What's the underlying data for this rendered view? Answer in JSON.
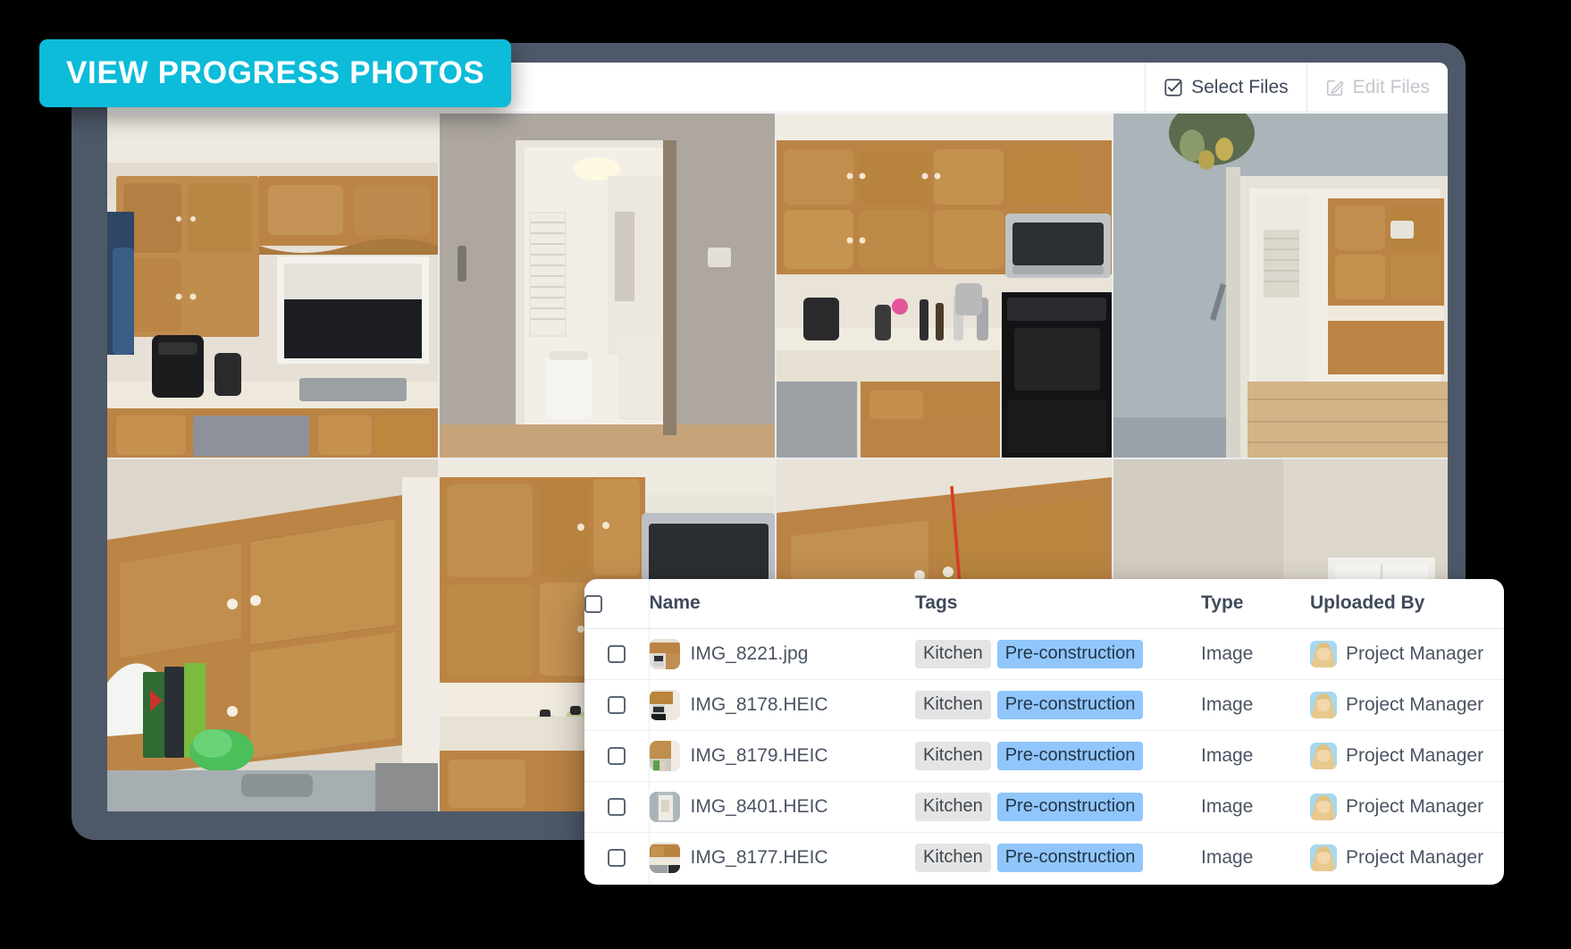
{
  "badge": {
    "label": "VIEW PROGRESS PHOTOS",
    "color": "#0cbcd9"
  },
  "card": {
    "background": "#4d5969"
  },
  "toolbar": {
    "buttons": [
      {
        "label": "Select Files",
        "icon": "checkbox-check-icon",
        "disabled": false
      },
      {
        "label": "Edit Files",
        "icon": "pencil-square-icon",
        "disabled": true
      }
    ]
  },
  "photo_grid": {
    "columns": 4,
    "rows": 2,
    "cells": [
      {
        "alt": "kitchen-oak-cabinets-window-sink"
      },
      {
        "alt": "hallway-doorway-to-bathroom"
      },
      {
        "alt": "kitchen-oak-cabinets-microwave-stove"
      },
      {
        "alt": "hallway-view-into-kitchen"
      },
      {
        "alt": "kitchen-cabinets-cereal-boxes-sink"
      },
      {
        "alt": "kitchen-cabinets-stove-kettle"
      },
      {
        "alt": "kitchen-upper-cabinets-wall"
      },
      {
        "alt": "empty-room-with-window"
      }
    ]
  },
  "file_table": {
    "headers": {
      "select_all": "",
      "name": "Name",
      "tags": "Tags",
      "type": "Type",
      "uploaded_by": "Uploaded By"
    },
    "tag_colors": {
      "gray": "#e4e4e4",
      "blue": "#90c6fb"
    },
    "rows": [
      {
        "checked": false,
        "thumb": "thumb-kitchen-1",
        "name": "IMG_8221.jpg",
        "tags": [
          "Kitchen",
          "Pre-construction"
        ],
        "type": "Image",
        "uploaded_by": "Project Manager",
        "avatar": "avatar-project-manager"
      },
      {
        "checked": false,
        "thumb": "thumb-kitchen-2",
        "name": "IMG_8178.HEIC",
        "tags": [
          "Kitchen",
          "Pre-construction"
        ],
        "type": "Image",
        "uploaded_by": "Project Manager",
        "avatar": "avatar-project-manager"
      },
      {
        "checked": false,
        "thumb": "thumb-kitchen-3",
        "name": "IMG_8179.HEIC",
        "tags": [
          "Kitchen",
          "Pre-construction"
        ],
        "type": "Image",
        "uploaded_by": "Project Manager",
        "avatar": "avatar-project-manager"
      },
      {
        "checked": false,
        "thumb": "thumb-kitchen-4",
        "name": "IMG_8401.HEIC",
        "tags": [
          "Kitchen",
          "Pre-construction"
        ],
        "type": "Image",
        "uploaded_by": "Project Manager",
        "avatar": "avatar-project-manager"
      },
      {
        "checked": false,
        "thumb": "thumb-kitchen-5",
        "name": "IMG_8177.HEIC",
        "tags": [
          "Kitchen",
          "Pre-construction"
        ],
        "type": "Image",
        "uploaded_by": "Project Manager",
        "avatar": "avatar-project-manager"
      }
    ]
  }
}
